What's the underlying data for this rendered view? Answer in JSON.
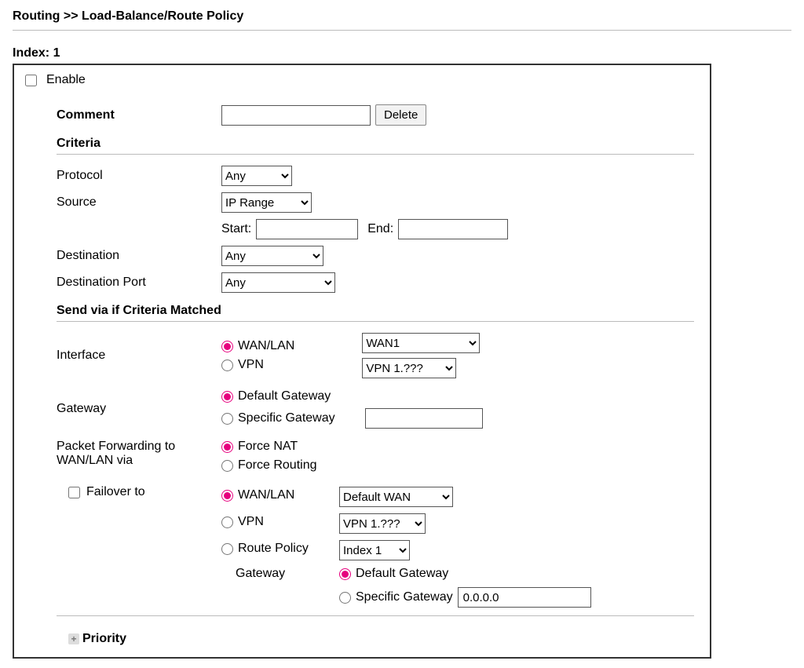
{
  "breadcrumb": "Routing >> Load-Balance/Route Policy",
  "index_label": "Index: 1",
  "enable_label": "Enable",
  "comment": {
    "label": "Comment",
    "value": "",
    "delete_btn": "Delete"
  },
  "criteria_heading": "Criteria",
  "protocol": {
    "label": "Protocol",
    "selected": "Any"
  },
  "source": {
    "label": "Source",
    "selected": "IP Range",
    "start_label": "Start:",
    "start_value": "",
    "end_label": "End:",
    "end_value": ""
  },
  "destination": {
    "label": "Destination",
    "selected": "Any"
  },
  "dest_port": {
    "label": "Destination Port",
    "selected": "Any"
  },
  "send_heading": "Send via if Criteria Matched",
  "interface": {
    "label": "Interface",
    "wanlan_label": "WAN/LAN",
    "wanlan_selected": "WAN1",
    "vpn_label": "VPN",
    "vpn_selected": "VPN 1.???"
  },
  "gateway": {
    "label": "Gateway",
    "default_label": "Default Gateway",
    "specific_label": "Specific Gateway",
    "specific_value": ""
  },
  "pkt_fwd": {
    "label1": "Packet Forwarding to",
    "label2": "WAN/LAN via",
    "force_nat": "Force NAT",
    "force_routing": "Force Routing"
  },
  "failover": {
    "checkbox_label": "Failover to",
    "wanlan_label": "WAN/LAN",
    "wanlan_selected": "Default WAN",
    "vpn_label": "VPN",
    "vpn_selected": "VPN 1.???",
    "route_policy_label": "Route Policy",
    "route_policy_selected": "Index 1",
    "gateway_label": "Gateway",
    "default_gw_label": "Default Gateway",
    "specific_gw_label": "Specific Gateway",
    "specific_gw_value": "0.0.0.0"
  },
  "priority_label": "Priority"
}
